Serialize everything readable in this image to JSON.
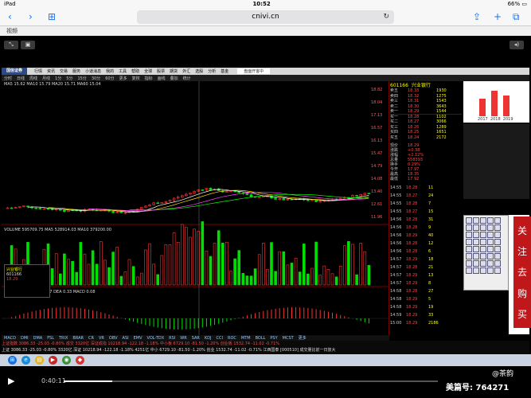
{
  "status": {
    "device": "iPad",
    "time": "10:52",
    "battery": "66%"
  },
  "browser": {
    "url": "cnivi.cn",
    "section": "视频"
  },
  "app": {
    "logo": "国信证券",
    "menu": [
      "行情",
      "资讯",
      "交易",
      "服务",
      "小道消息",
      "我的",
      "工具",
      "帮助",
      "全球",
      "股票",
      "期货",
      "外汇",
      "选股",
      "分析",
      "基金"
    ],
    "search_label": "盘面开客中",
    "chart_tabs": [
      "分时",
      "日线",
      "周线",
      "月线",
      "1分",
      "5分",
      "15分",
      "30分",
      "60分",
      "更多",
      "复权",
      "指标",
      "画线",
      "叠加",
      "统计"
    ],
    "indicator_tabs": [
      "MACD",
      "DMI",
      "DMA",
      "FSL",
      "TRIX",
      "BRAR",
      "CR",
      "VR",
      "OBV",
      "ASI",
      "EMV",
      "VOL-TDX",
      "RSI",
      "WR",
      "SAR",
      "KDJ",
      "CCI",
      "ROC",
      "MTM",
      "BOLL",
      "PSY",
      "MCST",
      "更多"
    ],
    "ma_line": "MA5 15.62  MA10 15.79  MA20 15.71  MA60 15.04",
    "price_labels": [
      "18.82",
      "18.04",
      "17.13",
      "16.57",
      "16.13",
      "15.47",
      "14.79",
      "14.08",
      "13.40",
      "12.61",
      "11.96"
    ],
    "vol_label": "VOLUME 595709.75  MA5 528914.03  MA10 379200.00",
    "macd_label": "MACD(12,26,9)  DIF 0.37  DEA 0.33  MACD 0.08",
    "stock": {
      "code": "601166",
      "name": "兴业银行",
      "price": "18.29",
      "change": "+0.38",
      "pct": "+2.12%"
    },
    "quotes": [
      {
        "label": "卖五",
        "price": "18.33",
        "vol": "1930"
      },
      {
        "label": "卖四",
        "price": "18.32",
        "vol": "1275"
      },
      {
        "label": "卖三",
        "price": "18.31",
        "vol": "1543"
      },
      {
        "label": "卖二",
        "price": "18.30",
        "vol": "3643"
      },
      {
        "label": "卖一",
        "price": "18.29",
        "vol": "1544"
      },
      {
        "label": "买一",
        "price": "18.28",
        "vol": "1102"
      },
      {
        "label": "买二",
        "price": "18.27",
        "vol": "3066"
      },
      {
        "label": "买三",
        "price": "18.26",
        "vol": "1289"
      },
      {
        "label": "买四",
        "price": "18.25",
        "vol": "1651"
      },
      {
        "label": "买五",
        "price": "18.24",
        "vol": "2172"
      }
    ],
    "stats": [
      {
        "label": "现价",
        "value": "18.29"
      },
      {
        "label": "涨跌",
        "value": "+0.38"
      },
      {
        "label": "涨幅",
        "value": "+2.12%"
      },
      {
        "label": "总量",
        "value": "558393"
      },
      {
        "label": "换手",
        "value": "0.29%"
      },
      {
        "label": "今开",
        "value": "17.97"
      },
      {
        "label": "最高",
        "value": "18.35"
      },
      {
        "label": "最低",
        "value": "17.92"
      }
    ],
    "ticks": [
      {
        "t": "14:55",
        "p": "18.28",
        "v": "11"
      },
      {
        "t": "14:55",
        "p": "18.27",
        "v": "24"
      },
      {
        "t": "14:55",
        "p": "18.28",
        "v": "7"
      },
      {
        "t": "14:55",
        "p": "18.27",
        "v": "15"
      },
      {
        "t": "14:56",
        "p": "18.28",
        "v": "31"
      },
      {
        "t": "14:56",
        "p": "18.28",
        "v": "9"
      },
      {
        "t": "14:56",
        "p": "18.29",
        "v": "40"
      },
      {
        "t": "14:56",
        "p": "18.28",
        "v": "12"
      },
      {
        "t": "14:56",
        "p": "18.28",
        "v": "6"
      },
      {
        "t": "14:57",
        "p": "18.29",
        "v": "18"
      },
      {
        "t": "14:57",
        "p": "18.28",
        "v": "21"
      },
      {
        "t": "14:57",
        "p": "18.29",
        "v": "13"
      },
      {
        "t": "14:57",
        "p": "18.29",
        "v": "8"
      },
      {
        "t": "14:58",
        "p": "18.28",
        "v": "27"
      },
      {
        "t": "14:58",
        "p": "18.29",
        "v": "5"
      },
      {
        "t": "14:58",
        "p": "18.29",
        "v": "19"
      },
      {
        "t": "14:59",
        "p": "18.29",
        "v": "33"
      },
      {
        "t": "15:00",
        "p": "18.29",
        "v": "2186"
      }
    ],
    "ticker": "上证指数 3086.33  -25.03  -0.80%  成交 3320亿   深证成指 10218.94  -122.18  -1.18%   中小板 6729.10  -81.50  -1.20%   创业板 1532.74  -11.02  -0.71%",
    "ticker2": "上证 3086.33 -25.03 -0.80%  3320亿   深证 10218.94 -122.18 -1.18%  4251亿   中小 6729.10 -81.50 -1.20%   创业 1532.74 -11.02 -0.71%   江西国泰 [000510] 成交量比前一日放大",
    "bars_summary": "2017  2018  2019"
  },
  "side_button": {
    "chars": [
      "关",
      "注",
      "去",
      "购",
      "买"
    ]
  },
  "player": {
    "time": "0:40:11",
    "progress": 0.13,
    "watermark_user": "@茶韵",
    "watermark_id": "美篇号: 764271"
  },
  "colors": {
    "up": "#ff3333",
    "down": "#00e000",
    "ma5": "#ffffff",
    "ma10": "#ffd700",
    "ma20": "#ff44ff",
    "ma60": "#00ff00"
  }
}
